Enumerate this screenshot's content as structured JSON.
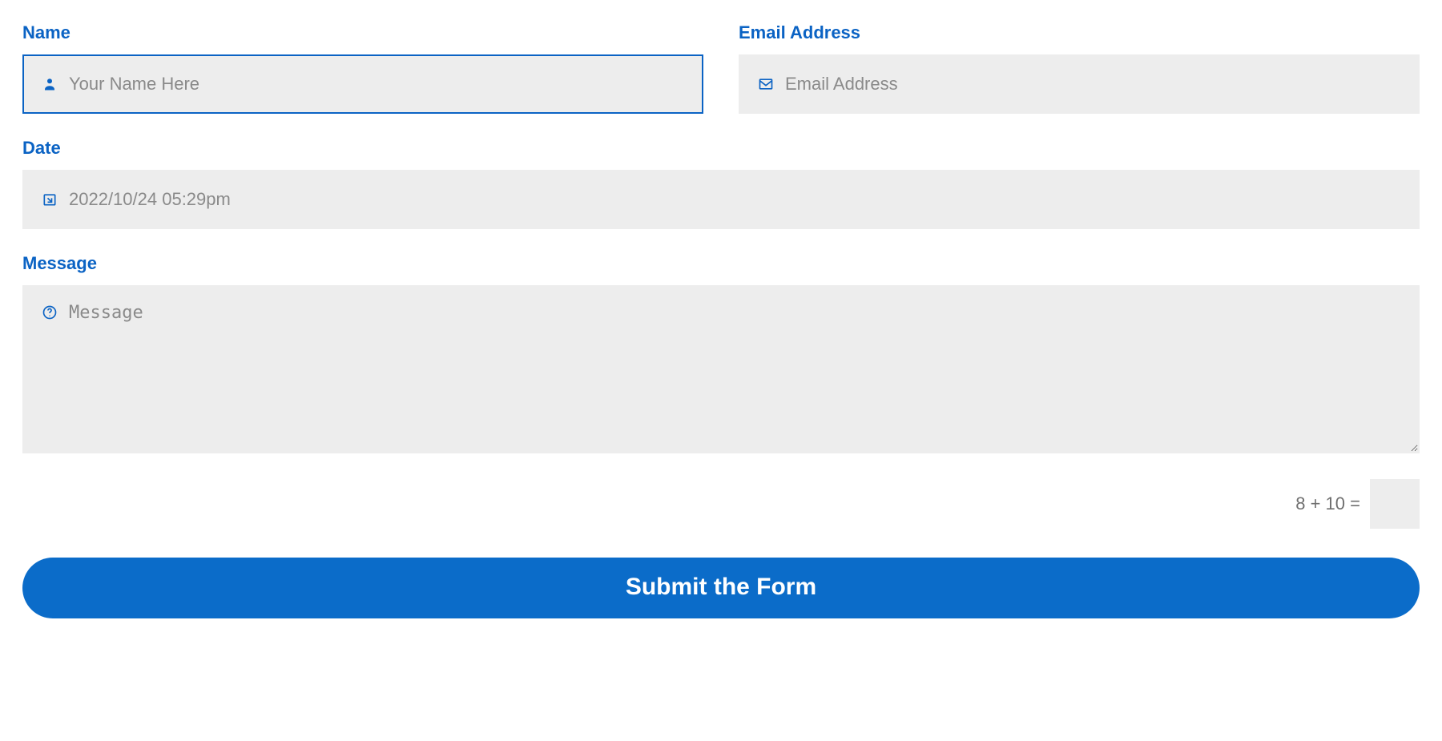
{
  "colors": {
    "accent": "#0b63c4",
    "input_bg": "#ededed",
    "submit_bg": "#0b6cc9"
  },
  "fields": {
    "name": {
      "label": "Name",
      "placeholder": "Your Name Here",
      "value": "",
      "icon": "person-icon"
    },
    "email": {
      "label": "Email Address",
      "placeholder": "Email Address",
      "value": "",
      "icon": "mail-icon"
    },
    "date": {
      "label": "Date",
      "placeholder": "2022/10/24 05:29pm",
      "value": "",
      "icon": "calendar-arrow-icon"
    },
    "message": {
      "label": "Message",
      "placeholder": "Message",
      "value": "",
      "icon": "help-icon"
    }
  },
  "captcha": {
    "prompt": "8 + 10 =",
    "value": ""
  },
  "submit": {
    "label": "Submit the Form"
  }
}
